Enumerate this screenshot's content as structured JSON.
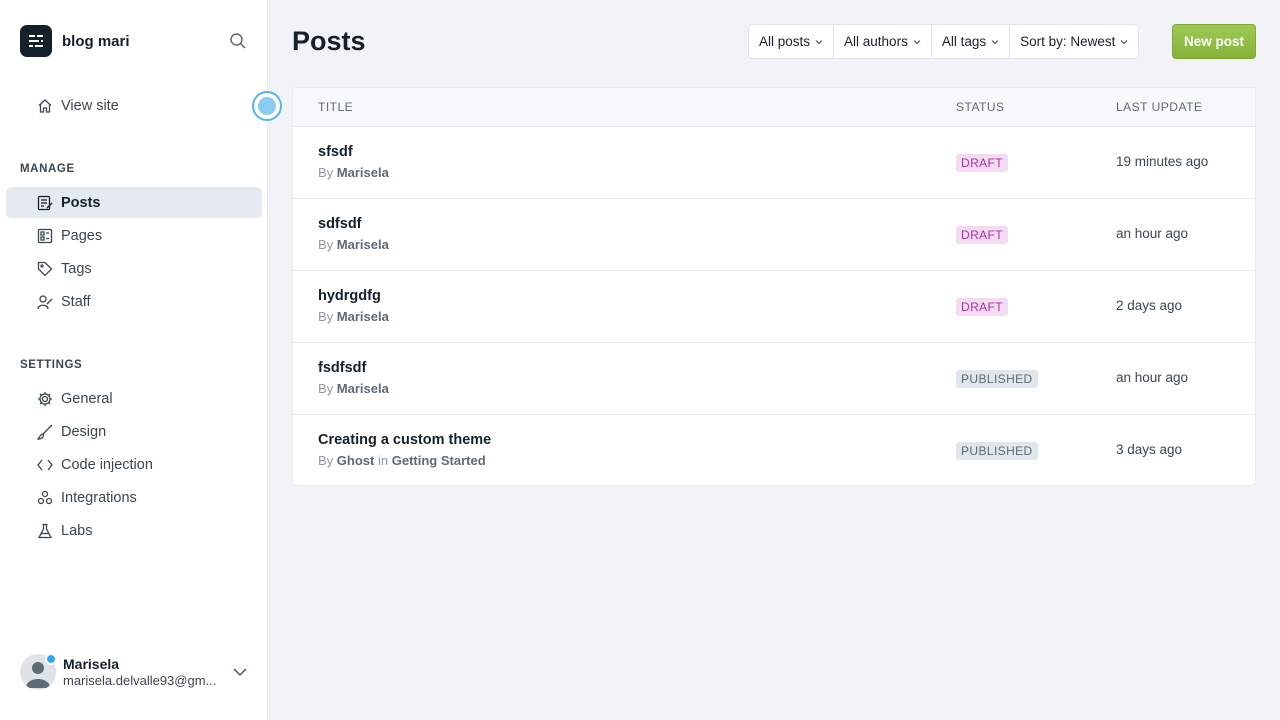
{
  "sidebar": {
    "brand": "blog mari",
    "view_site": "View site",
    "manage_title": "MANAGE",
    "manage_items": [
      {
        "label": "Posts",
        "icon": "posts-icon",
        "active": true
      },
      {
        "label": "Pages",
        "icon": "pages-icon"
      },
      {
        "label": "Tags",
        "icon": "tag-icon"
      },
      {
        "label": "Staff",
        "icon": "staff-icon"
      }
    ],
    "settings_title": "SETTINGS",
    "settings_items": [
      {
        "label": "General",
        "icon": "gear-icon"
      },
      {
        "label": "Design",
        "icon": "brush-icon"
      },
      {
        "label": "Code injection",
        "icon": "code-icon"
      },
      {
        "label": "Integrations",
        "icon": "integrations-icon"
      },
      {
        "label": "Labs",
        "icon": "flask-icon"
      }
    ],
    "user": {
      "name": "Marisela",
      "email": "marisela.delvalle93@gm..."
    }
  },
  "main": {
    "title": "Posts",
    "filters": [
      "All posts",
      "All authors",
      "All tags",
      "Sort by: Newest"
    ],
    "new_post": "New post",
    "columns": [
      "TITLE",
      "STATUS",
      "LAST UPDATE"
    ],
    "posts": [
      {
        "title": "sfsdf",
        "by": "By",
        "author": "Marisela",
        "in": "",
        "tag": "",
        "status": "DRAFT",
        "updated": "19 minutes ago"
      },
      {
        "title": "sdfsdf",
        "by": "By",
        "author": "Marisela",
        "in": "",
        "tag": "",
        "status": "DRAFT",
        "updated": "an hour ago"
      },
      {
        "title": "hydrgdfg",
        "by": "By",
        "author": "Marisela",
        "in": "",
        "tag": "",
        "status": "DRAFT",
        "updated": "2 days ago"
      },
      {
        "title": "fsdfsdf",
        "by": "By",
        "author": "Marisela",
        "in": "",
        "tag": "",
        "status": "PUBLISHED",
        "updated": "an hour ago"
      },
      {
        "title": "Creating a custom theme",
        "by": "By",
        "author": "Ghost",
        "in": "in",
        "tag": "Getting Started",
        "status": "PUBLISHED",
        "updated": "3 days ago"
      }
    ]
  },
  "colors": {
    "accent_green": "#9ec954",
    "draft_bg": "#f3dcf1",
    "draft_text": "#ae2fa8",
    "published_bg": "#dfe6ec"
  }
}
